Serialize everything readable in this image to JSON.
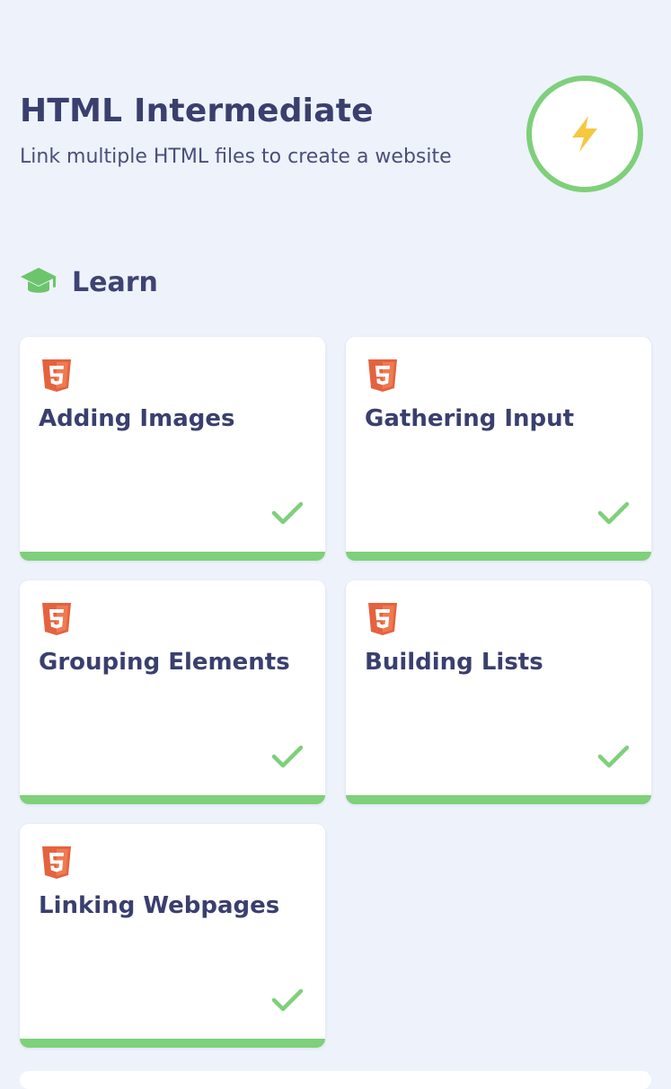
{
  "course": {
    "title": "HTML Intermediate",
    "subtitle": "Link multiple HTML files to create a website",
    "badge_icon": "lightning-bolt-icon",
    "badge_ring_color": "#7ed07a",
    "badge_icon_color": "#f5c842"
  },
  "section": {
    "title": "Learn",
    "icon": "graduation-cap-icon",
    "icon_color": "#6cc56c"
  },
  "lessons": [
    {
      "title": "Adding Images",
      "icon": "html5-icon",
      "completed": true,
      "progress": 1.0
    },
    {
      "title": "Gathering Input",
      "icon": "html5-icon",
      "completed": true,
      "progress": 1.0
    },
    {
      "title": "Grouping Elements",
      "icon": "html5-icon",
      "completed": true,
      "progress": 1.0
    },
    {
      "title": "Building Lists",
      "icon": "html5-icon",
      "completed": true,
      "progress": 1.0
    },
    {
      "title": "Linking Webpages",
      "icon": "html5-icon",
      "completed": true,
      "progress": 1.0
    }
  ],
  "colors": {
    "background": "#eef2fb",
    "accent_green": "#7ed07a",
    "html5_orange": "#e5623f",
    "text_dark": "#3a3f6e"
  }
}
